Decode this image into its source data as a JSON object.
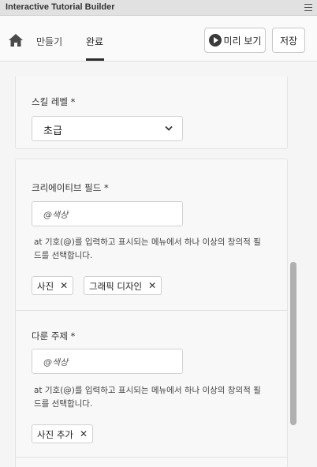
{
  "window": {
    "title": "Interactive Tutorial Builder"
  },
  "header": {
    "tabs": [
      {
        "label": "만들기"
      },
      {
        "label": "완료"
      }
    ],
    "active_tab": "완료",
    "preview_label": "미리 보기",
    "save_label": "저장"
  },
  "skill_level": {
    "label": "스킬 레벨 *",
    "value": "초급"
  },
  "creative_field": {
    "label": "크리에이티브 필드 *",
    "placeholder": "@색상",
    "help": "at 기호(@)를 입력하고 표시되는 메뉴에서 하나 이상의 창의적 필드를 선택합니다.",
    "chips": [
      {
        "label": "사진"
      },
      {
        "label": "그래픽 디자인"
      }
    ]
  },
  "topics": {
    "label": "다룬 주제 *",
    "placeholder": "@색상",
    "help": "at 기호(@)를 입력하고 표시되는 메뉴에서 하나 이상의 창의적 필드를 선택합니다.",
    "chips": [
      {
        "label": "사진 추가"
      }
    ]
  },
  "icons": {
    "home": "home-icon",
    "menu": "hamburger-menu-icon",
    "play": "play-icon",
    "chevron": "chevron-down-icon",
    "remove": "close-icon"
  }
}
